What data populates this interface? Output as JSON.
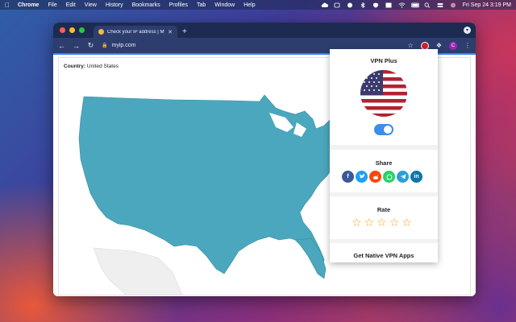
{
  "menubar": {
    "app": "Chrome",
    "items": [
      "File",
      "Edit",
      "View",
      "History",
      "Bookmarks",
      "Profiles",
      "Tab",
      "Window",
      "Help"
    ],
    "clock": "Fri Sep 24  3:19 PM"
  },
  "browser": {
    "tab_title": "Check your IP address | MyIP...",
    "url": "myip.com",
    "new_tab_symbol": "+",
    "profile_initial": "C"
  },
  "page": {
    "country_label": "Country:",
    "country_value": "United States",
    "map_color": "#4ba7bd"
  },
  "popup": {
    "title": "VPN Plus",
    "vpn_enabled": true,
    "share_title": "Share",
    "share_icons": [
      "facebook-icon",
      "twitter-icon",
      "reddit-icon",
      "whatsapp-icon",
      "telegram-icon",
      "linkedin-icon"
    ],
    "rate_title": "Rate",
    "star_count": 5,
    "native_apps_label": "Get Native VPN Apps",
    "accent": "#3b8eea"
  }
}
